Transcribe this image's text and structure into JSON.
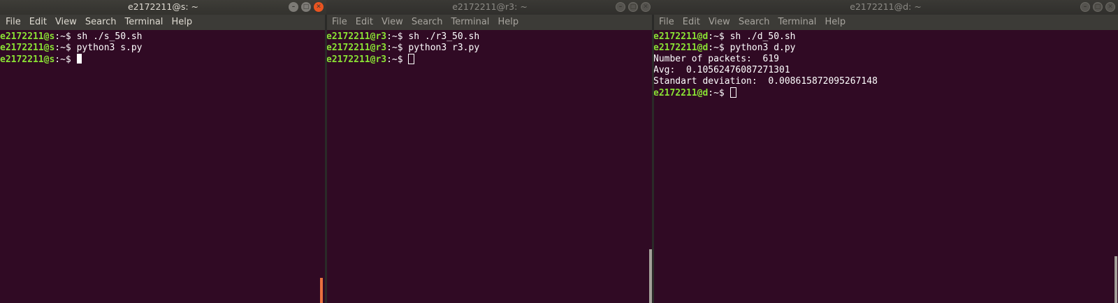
{
  "terminals": [
    {
      "title": "e2172211@s: ~",
      "menu": [
        "File",
        "Edit",
        "View",
        "Search",
        "Terminal",
        "Help"
      ],
      "lines": [
        {
          "user": "e2172211@s",
          "path": ":~$ ",
          "cmd": "sh ./s_50.sh"
        },
        {
          "user": "e2172211@s",
          "path": ":~$ ",
          "cmd": "python3 s.py"
        },
        {
          "user": "e2172211@s",
          "path": ":~$ ",
          "cmd": ""
        }
      ]
    },
    {
      "title": "e2172211@r3: ~",
      "menu": [
        "File",
        "Edit",
        "View",
        "Search",
        "Terminal",
        "Help"
      ],
      "lines": [
        {
          "user": "e2172211@r3",
          "path": ":~$ ",
          "cmd": "sh ./r3_50.sh"
        },
        {
          "user": "e2172211@r3",
          "path": ":~$ ",
          "cmd": "python3 r3.py"
        },
        {
          "user": "e2172211@r3",
          "path": ":~$ ",
          "cmd": ""
        }
      ]
    },
    {
      "title": "e2172211@d: ~",
      "menu": [
        "File",
        "Edit",
        "View",
        "Search",
        "Terminal",
        "Help"
      ],
      "lines": [
        {
          "user": "e2172211@d",
          "path": ":~$ ",
          "cmd": "sh ./d_50.sh"
        },
        {
          "user": "e2172211@d",
          "path": ":~$ ",
          "cmd": "python3 d.py"
        }
      ],
      "output": [
        "Number of packets:  619",
        "Avg:  0.10562476087271301",
        "Standart deviation:  0.008615872095267148"
      ],
      "final_prompt": {
        "user": "e2172211@d",
        "path": ":~$ "
      }
    }
  ],
  "colors": {
    "background": "#300a24",
    "prompt": "#8ae234",
    "text": "#ffffff",
    "titlebar": "#3c3b37",
    "close_active": "#e95420"
  },
  "icons": {
    "minimize": "minimize-icon",
    "maximize": "maximize-icon",
    "close": "close-icon"
  }
}
